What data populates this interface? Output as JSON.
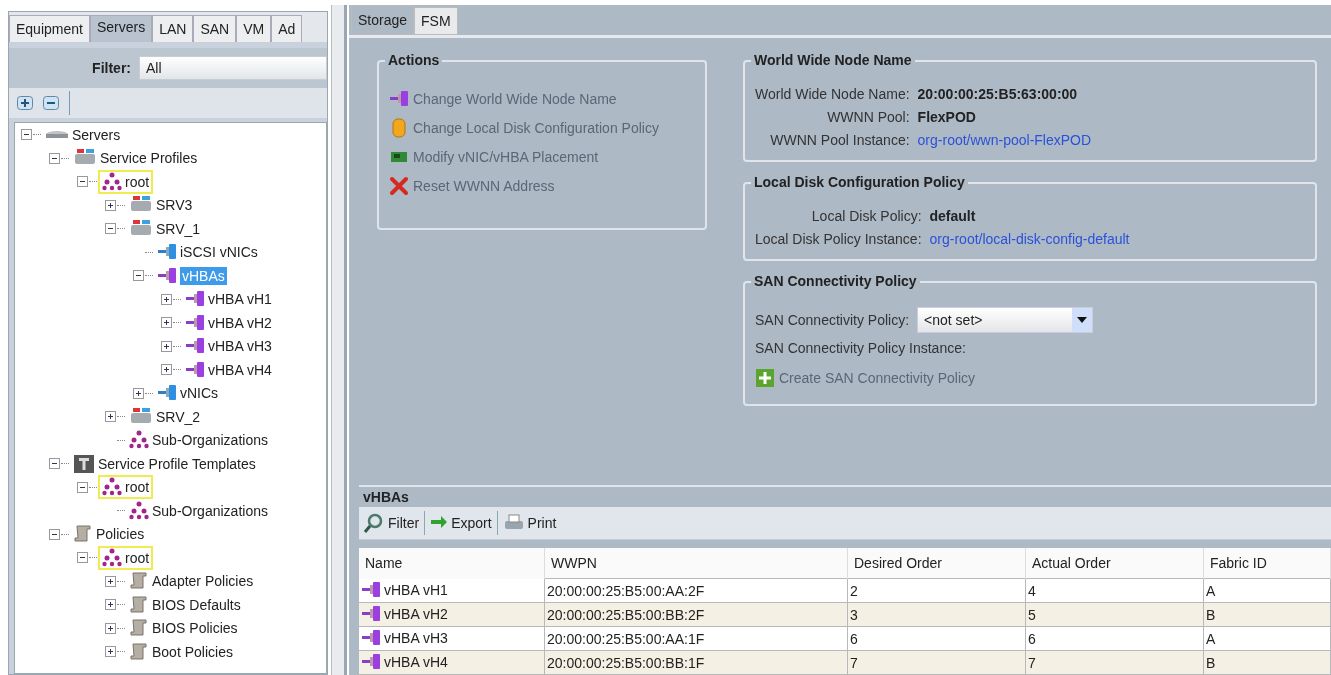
{
  "nav_tabs": [
    {
      "label": "Equipment",
      "selected": false
    },
    {
      "label": "Servers",
      "selected": true
    },
    {
      "label": "LAN",
      "selected": false
    },
    {
      "label": "SAN",
      "selected": false
    },
    {
      "label": "VM",
      "selected": false
    },
    {
      "label": "Ad",
      "selected": false
    }
  ],
  "filter": {
    "label": "Filter:",
    "value": "All"
  },
  "tree": [
    {
      "kind": "servers",
      "label": "Servers",
      "expanded": true,
      "selected": false,
      "outlined": false,
      "children": [
        {
          "kind": "profiles",
          "label": "Service Profiles",
          "expanded": true,
          "selected": false,
          "outlined": false,
          "children": [
            {
              "kind": "org",
              "label": "root",
              "expanded": true,
              "selected": false,
              "outlined": true,
              "children": [
                {
                  "kind": "server",
                  "label": "SRV3",
                  "expanded": false,
                  "selected": false,
                  "outlined": false
                },
                {
                  "kind": "server",
                  "label": "SRV_1",
                  "expanded": true,
                  "selected": false,
                  "outlined": false,
                  "children": [
                    {
                      "kind": "nic",
                      "label": "iSCSI vNICs",
                      "selected": false,
                      "outlined": false
                    },
                    {
                      "kind": "hba",
                      "label": "vHBAs",
                      "expanded": true,
                      "selected": true,
                      "outlined": false,
                      "children": [
                        {
                          "kind": "hba",
                          "label": "vHBA vH1",
                          "expanded": false,
                          "selected": false,
                          "outlined": false
                        },
                        {
                          "kind": "hba",
                          "label": "vHBA vH2",
                          "expanded": false,
                          "selected": false,
                          "outlined": false
                        },
                        {
                          "kind": "hba",
                          "label": "vHBA vH3",
                          "expanded": false,
                          "selected": false,
                          "outlined": false
                        },
                        {
                          "kind": "hba",
                          "label": "vHBA vH4",
                          "expanded": false,
                          "selected": false,
                          "outlined": false
                        }
                      ]
                    },
                    {
                      "kind": "nic",
                      "label": "vNICs",
                      "expanded": false,
                      "selected": false,
                      "outlined": false
                    }
                  ]
                },
                {
                  "kind": "server",
                  "label": "SRV_2",
                  "expanded": false,
                  "selected": false,
                  "outlined": false
                },
                {
                  "kind": "org",
                  "label": "Sub-Organizations",
                  "selected": false,
                  "outlined": false
                }
              ]
            }
          ]
        },
        {
          "kind": "template",
          "label": "Service Profile Templates",
          "expanded": true,
          "selected": false,
          "outlined": false,
          "children": [
            {
              "kind": "org",
              "label": "root",
              "expanded": true,
              "selected": false,
              "outlined": true,
              "children": [
                {
                  "kind": "org",
                  "label": "Sub-Organizations",
                  "selected": false,
                  "outlined": false
                }
              ]
            }
          ]
        },
        {
          "kind": "policy",
          "label": "Policies",
          "expanded": true,
          "selected": false,
          "outlined": false,
          "children": [
            {
              "kind": "org",
              "label": "root",
              "expanded": true,
              "selected": false,
              "outlined": true,
              "children": [
                {
                  "kind": "policy",
                  "label": "Adapter Policies",
                  "expanded": false,
                  "selected": false,
                  "outlined": false
                },
                {
                  "kind": "policy",
                  "label": "BIOS Defaults",
                  "expanded": false,
                  "selected": false,
                  "outlined": false
                },
                {
                  "kind": "policy",
                  "label": "BIOS Policies",
                  "expanded": false,
                  "selected": false,
                  "outlined": false
                },
                {
                  "kind": "policy",
                  "label": "Boot Policies",
                  "expanded": false,
                  "selected": false,
                  "outlined": false
                }
              ]
            }
          ]
        }
      ]
    }
  ],
  "content_tabs": [
    {
      "label": "Storage",
      "selected": true
    },
    {
      "label": "FSM",
      "selected": false
    }
  ],
  "actions": {
    "title": "Actions",
    "items": [
      {
        "kind": "hba",
        "label": "Change World Wide Node Name"
      },
      {
        "kind": "disk",
        "label": "Change Local Disk Configuration Policy"
      },
      {
        "kind": "card",
        "label": "Modify vNIC/vHBA Placement"
      },
      {
        "kind": "delete",
        "label": "Reset WWNN Address"
      }
    ]
  },
  "groups": [
    {
      "title": "World Wide Node Name",
      "fields": [
        {
          "kind": "value",
          "label": "World Wide Node Name:",
          "value": "20:00:00:25:B5:63:00:00"
        },
        {
          "kind": "value",
          "label": "WWNN Pool:",
          "value": "FlexPOD"
        },
        {
          "kind": "link",
          "label": "WWNN Pool Instance:",
          "value": "org-root/wwn-pool-FlexPOD"
        }
      ]
    },
    {
      "title": "Local Disk Configuration Policy",
      "fields": [
        {
          "kind": "value",
          "label": "Local Disk Policy:",
          "value": "default"
        },
        {
          "kind": "link",
          "label": "Local Disk Policy Instance:",
          "value": "org-root/local-disk-config-default"
        }
      ]
    },
    {
      "title": "SAN Connectivity Policy",
      "fields": [
        {
          "kind": "select",
          "label": "SAN Connectivity Policy:",
          "value": "<not set>"
        },
        {
          "kind": "label",
          "label": "SAN Connectivity Policy Instance:"
        },
        {
          "kind": "create",
          "label": "Create SAN Connectivity Policy"
        }
      ]
    }
  ],
  "vhbas": {
    "title": "vHBAs",
    "toolbar": [
      {
        "kind": "filter",
        "label": "Filter"
      },
      {
        "kind": "export",
        "label": "Export"
      },
      {
        "kind": "print",
        "label": "Print"
      }
    ],
    "columns": [
      "Name",
      "WWPN",
      "Desired Order",
      "Actual Order",
      "Fabric ID"
    ],
    "rows": [
      [
        "vHBA vH1",
        "20:00:00:25:B5:00:AA:2F",
        "2",
        "4",
        "A"
      ],
      [
        "vHBA vH2",
        "20:00:00:25:B5:00:BB:2F",
        "3",
        "5",
        "B"
      ],
      [
        "vHBA vH3",
        "20:00:00:25:B5:00:AA:1F",
        "6",
        "6",
        "A"
      ],
      [
        "vHBA vH4",
        "20:00:00:25:B5:00:BB:1F",
        "7",
        "7",
        "B"
      ]
    ]
  }
}
